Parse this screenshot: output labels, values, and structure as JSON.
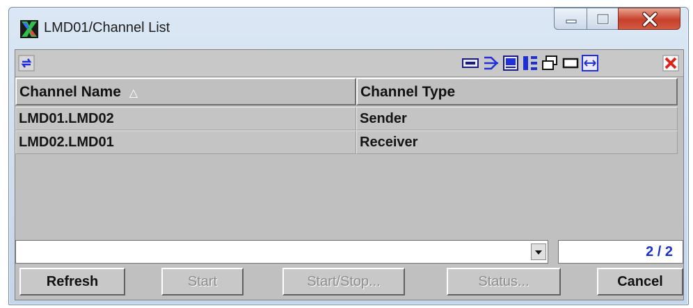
{
  "window": {
    "title": "LMD01/Channel List"
  },
  "titlebar_buttons": {
    "minimize": "minimize",
    "maximize": "maximize",
    "close": "close"
  },
  "toolbar": {
    "left": [
      "refresh-arrows-icon"
    ],
    "right": [
      "filter-icon",
      "split-icon",
      "columns-icon",
      "tile-icon",
      "cascade-icon",
      "single-pane-icon",
      "fit-width-icon",
      "close-window-icon"
    ]
  },
  "table": {
    "columns": [
      "Channel Name",
      "Channel Type"
    ],
    "sort_indicator": "△",
    "rows": [
      {
        "name": "LMD01.LMD02",
        "type": "Sender"
      },
      {
        "name": "LMD02.LMD01",
        "type": "Receiver"
      }
    ]
  },
  "filter_combo": {
    "value": ""
  },
  "counter": "2 / 2",
  "buttons": {
    "refresh": "Refresh",
    "start": "Start",
    "start_stop": "Start/Stop...",
    "status": "Status...",
    "cancel": "Cancel"
  },
  "colors": {
    "accent": "#1a2fd0",
    "grid": "#c0c0c0"
  }
}
